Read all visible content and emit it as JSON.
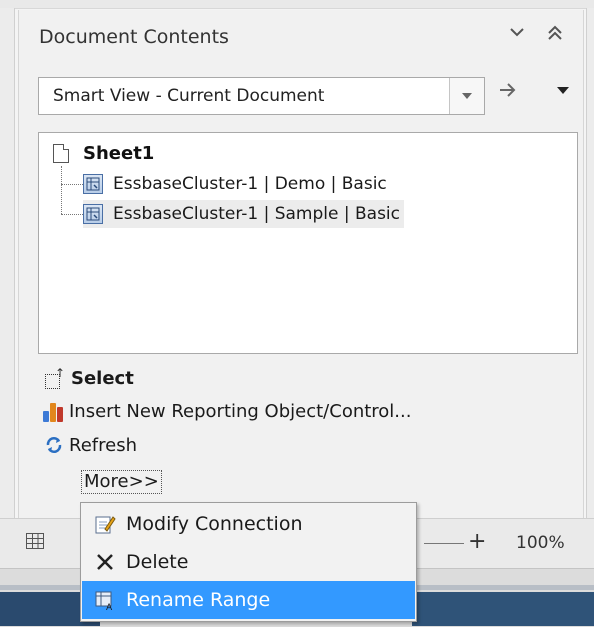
{
  "panel": {
    "title": "Document Contents",
    "collapse_icon": "chevron-down-icon",
    "minimize_icon": "double-chevron-up-icon"
  },
  "source_selector": {
    "value": "Smart View - Current Document",
    "go_icon": "arrow-right-icon",
    "menu_icon": "caret-down-icon"
  },
  "tree": {
    "sheet": "Sheet1",
    "connections": [
      {
        "label": "EssbaseCluster-1 | Demo | Basic",
        "selected": false
      },
      {
        "label": "EssbaseCluster-1 | Sample | Basic",
        "selected": true
      }
    ]
  },
  "actions": {
    "select": "Select",
    "insert": "Insert New Reporting Object/Control...",
    "refresh": "Refresh",
    "more": "More>>"
  },
  "status_bar": {
    "zoom_plus": "+",
    "zoom_level": "100%"
  },
  "context_menu": {
    "items": [
      {
        "label": "Modify Connection",
        "icon": "edit-connection-icon",
        "highlighted": false
      },
      {
        "label": "Delete",
        "icon": "delete-x-icon",
        "highlighted": false
      },
      {
        "label": "Rename Range",
        "icon": "rename-range-icon",
        "highlighted": true
      }
    ]
  },
  "colors": {
    "highlight": "#3399ff",
    "selected_row": "#ececec"
  }
}
